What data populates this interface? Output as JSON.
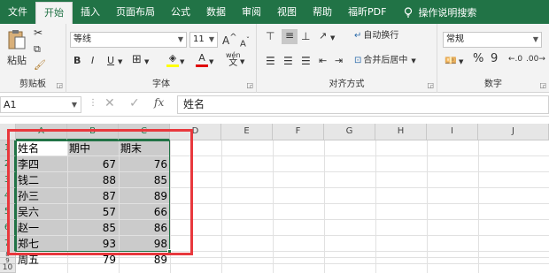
{
  "tabs": [
    "文件",
    "开始",
    "插入",
    "页面布局",
    "公式",
    "数据",
    "审阅",
    "视图",
    "帮助",
    "福昕PDF"
  ],
  "active_tab": "开始",
  "search_label": "操作说明搜索",
  "ribbon": {
    "clipboard": {
      "paste_label": "粘贴",
      "group_label": "剪贴板"
    },
    "font": {
      "font_name": "等线",
      "font_size": "11",
      "grow": "A",
      "shrink": "A",
      "bold": "B",
      "italic": "I",
      "underline": "U",
      "phonetic": "wén",
      "group_label": "字体"
    },
    "alignment": {
      "wrap_text": "自动换行",
      "merge_center": "合并后居中",
      "group_label": "对齐方式"
    },
    "number": {
      "format": "常规",
      "percent": "%",
      "comma": "9",
      "group_label": "数字"
    }
  },
  "formula_bar": {
    "name_box": "A1",
    "fx": "fx",
    "content": "姓名"
  },
  "columns": [
    "A",
    "B",
    "C",
    "D",
    "E",
    "F",
    "G",
    "H",
    "I",
    "J"
  ],
  "rows": [
    "1",
    "2",
    "3",
    "4",
    "5",
    "6",
    "7",
    "8",
    "9",
    "10"
  ],
  "table": {
    "headers": [
      "姓名",
      "期中",
      "期末"
    ],
    "rows": [
      [
        "李四",
        "67",
        "76"
      ],
      [
        "钱二",
        "88",
        "85"
      ],
      [
        "孙三",
        "87",
        "89"
      ],
      [
        "吴六",
        "57",
        "66"
      ],
      [
        "赵一",
        "85",
        "86"
      ],
      [
        "郑七",
        "93",
        "98"
      ],
      [
        "周五",
        "79",
        "89"
      ]
    ]
  },
  "colors": {
    "excel_green": "#217346",
    "highlight_red": "#e8383d",
    "selection_gray": "#cbcbcb"
  }
}
